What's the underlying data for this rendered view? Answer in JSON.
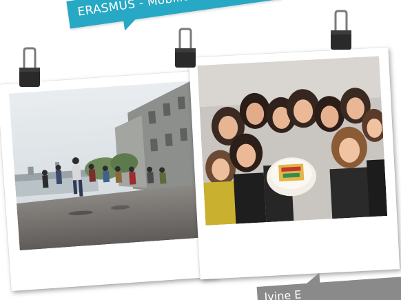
{
  "banner_top": {
    "text": "ERASMUS - Mobilitnost",
    "color": "#27a8c4"
  },
  "banner_bottom": {
    "text": "Ivine E",
    "color": "#8a8a8a"
  },
  "photos": [
    {
      "name": "left-polaroid",
      "subject": "group of people jumping on a riverside promenade"
    },
    {
      "name": "right-polaroid",
      "subject": "group of young women holding a cake"
    }
  ],
  "icons": [
    "binder-clip-icon"
  ]
}
